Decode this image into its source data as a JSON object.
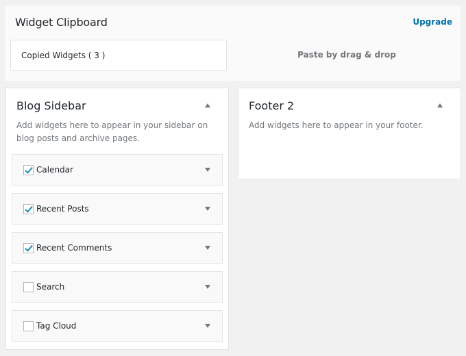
{
  "clipboard": {
    "title": "Widget Clipboard",
    "upgrade": "Upgrade",
    "copied": "Copied Widgets ( 3 )",
    "paste": "Paste by drag & drop"
  },
  "blog_sidebar": {
    "title": "Blog Sidebar",
    "description": "Add widgets here to appear in your sidebar on blog posts and archive pages.",
    "widgets": [
      {
        "label": "Calendar",
        "checked": true
      },
      {
        "label": "Recent Posts",
        "checked": true
      },
      {
        "label": "Recent Comments",
        "checked": true
      },
      {
        "label": "Search",
        "checked": false
      },
      {
        "label": "Tag Cloud",
        "checked": false
      }
    ]
  },
  "footer2": {
    "title": "Footer 2",
    "description": "Add widgets here to appear in your footer."
  },
  "colors": {
    "accent": "#0073aa",
    "check": "#1e8cbe",
    "background": "#f1f1f1"
  }
}
